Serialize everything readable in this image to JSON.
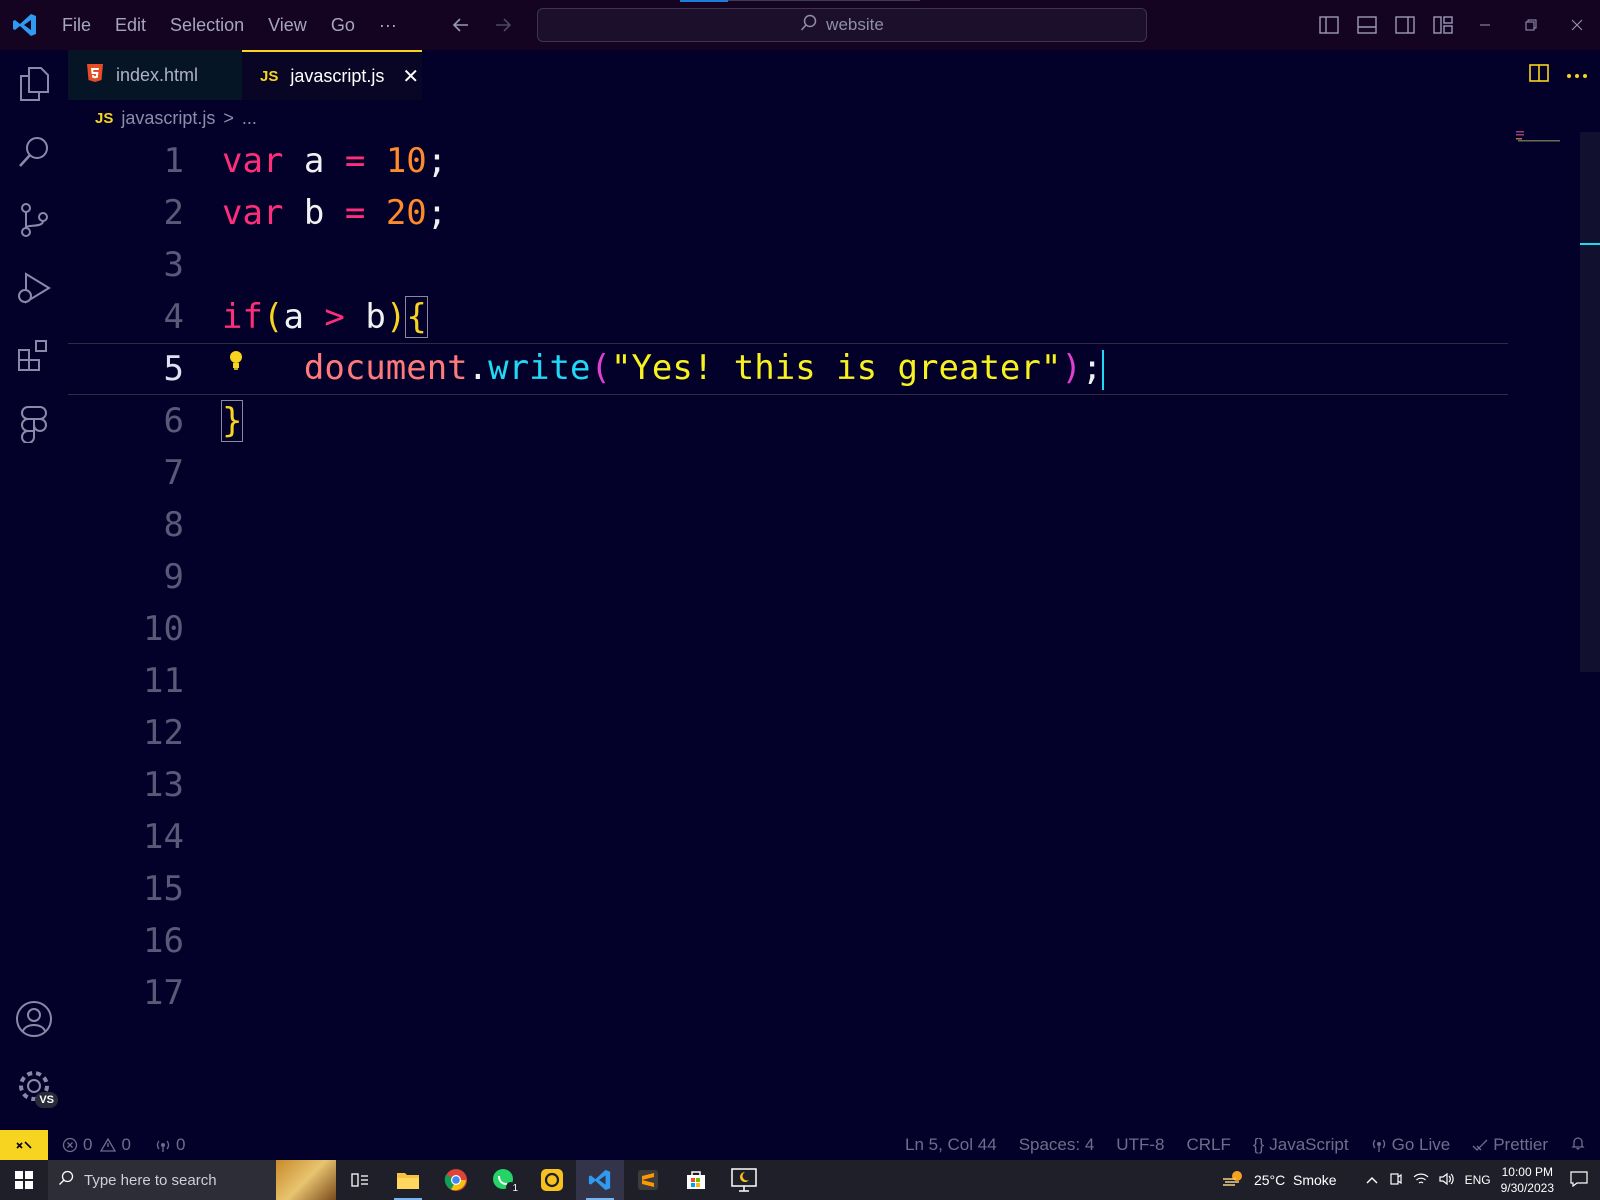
{
  "titlebar": {
    "menu": [
      "File",
      "Edit",
      "Selection",
      "View",
      "Go",
      "···"
    ],
    "search_text": "website"
  },
  "tabs": [
    {
      "icon": "html5-icon",
      "label": "index.html",
      "active": false
    },
    {
      "icon": "js-icon",
      "icon_text": "JS",
      "label": "javascript.js",
      "active": true,
      "close": "✕"
    }
  ],
  "breadcrumb": {
    "icon_text": "JS",
    "file": "javascript.js",
    "sep": ">",
    "more": "..."
  },
  "editor": {
    "line_numbers": [
      "1",
      "2",
      "3",
      "4",
      "5",
      "6",
      "7",
      "8",
      "9",
      "10",
      "11",
      "12",
      "13",
      "14",
      "15",
      "16",
      "17"
    ],
    "active_line": 5,
    "lines": [
      [
        "var",
        " a ",
        "=",
        " ",
        "10",
        ";"
      ],
      [
        "var",
        " b ",
        "=",
        " ",
        "20",
        ";"
      ],
      [],
      [
        "if",
        "(",
        "a ",
        ">",
        " b",
        ")",
        "{"
      ],
      [
        "    ",
        "document",
        ".",
        "write",
        "(",
        "\"Yes! this is greater\"",
        ")",
        ";"
      ],
      [
        "}"
      ]
    ]
  },
  "statusbar": {
    "errors": "0",
    "warnings": "0",
    "ports": "0",
    "position": "Ln 5, Col 44",
    "spaces": "Spaces: 4",
    "encoding": "UTF-8",
    "eol": "CRLF",
    "language": "JavaScript",
    "go_live": "Go Live",
    "prettier": "Prettier"
  },
  "accounts_badge": "VS",
  "taskbar": {
    "search_placeholder": "Type here to search",
    "whatsapp_badge": "1",
    "weather": "25°C  Smoke",
    "lang": "ENG",
    "time": "10:00 PM",
    "date": "9/30/2023"
  },
  "colors": {
    "background": "#03012a",
    "keyword": "#ff2e7a",
    "number": "#ff8a2c",
    "function": "#20d9f4",
    "string": "#f7f21f",
    "accent": "#f7d41f"
  }
}
